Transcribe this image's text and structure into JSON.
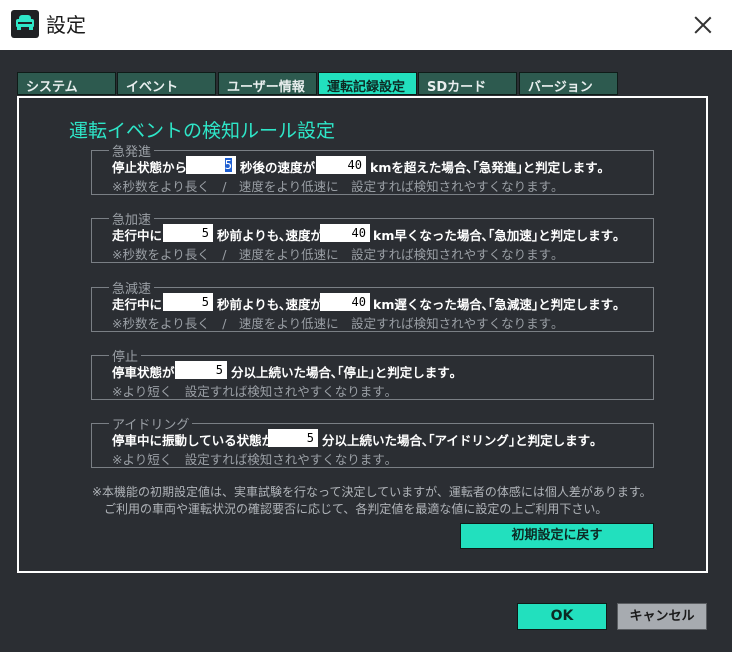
{
  "window": {
    "title": "設定"
  },
  "tabs": [
    {
      "label": "システム"
    },
    {
      "label": "イベント"
    },
    {
      "label": "ユーザー情報"
    },
    {
      "label": "運転記録設定"
    },
    {
      "label": "SDカード"
    },
    {
      "label": "バージョン"
    }
  ],
  "active_tab_index": 3,
  "panel": {
    "title": "運転イベントの検知ルール設定"
  },
  "groups": {
    "sudden_start": {
      "legend": "急発進",
      "text1": "停止状態から",
      "seconds": "5",
      "text2": "秒後の速度が",
      "speed": "40",
      "text3": "kmを超えた場合､｢急発進｣と判定します｡",
      "note": "※秒数をより長く　/　速度をより低速に　設定すれば検知されやすくなります｡"
    },
    "sudden_accel": {
      "legend": "急加速",
      "text1": "走行中に",
      "seconds": "5",
      "text2": "秒前よりも､速度が",
      "speed": "40",
      "text3": "km早くなった場合､｢急加速｣と判定します｡",
      "note": "※秒数をより長く　/　速度をより低速に　設定すれば検知されやすくなります｡"
    },
    "sudden_decel": {
      "legend": "急減速",
      "text1": "走行中に",
      "seconds": "5",
      "text2": "秒前よりも､速度が",
      "speed": "40",
      "text3": "km遅くなった場合､｢急減速｣と判定します｡",
      "note": "※秒数をより長く　/　速度をより低速に　設定すれば検知されやすくなります｡"
    },
    "stop": {
      "legend": "停止",
      "text1": "停車状態が",
      "minutes": "5",
      "text2": "分以上続いた場合､｢停止｣と判定します｡",
      "note": "※より短く　設定すれば検知されやすくなります｡"
    },
    "idling": {
      "legend": "アイドリング",
      "text1": "停車中に振動している状態が",
      "minutes": "5",
      "text2": "分以上続いた場合､｢アイドリング｣と判定します｡",
      "note": "※より短く　設定すれば検知されやすくなります｡"
    }
  },
  "footnote": {
    "line1": "※本機能の初期設定値は、実車試験を行なって決定していますが、運転者の体感には個人差があります。",
    "line2": "　ご利用の車両や運転状況の確認要否に応じて、各判定値を最適な値に設定の上ご利用下さい。"
  },
  "buttons": {
    "reset": "初期設定に戻す",
    "ok": "OK",
    "cancel": "キャンセル"
  },
  "colors": {
    "accent": "#22e0be",
    "background": "#2b2e33",
    "tab_inactive": "#2d5a4f"
  }
}
